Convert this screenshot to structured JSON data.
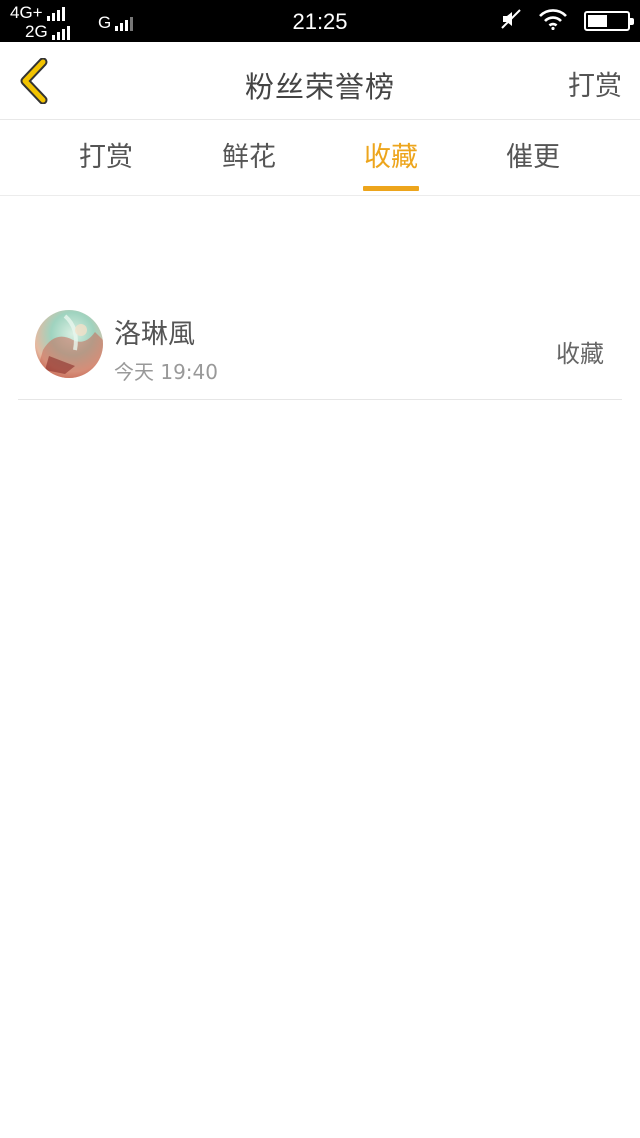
{
  "status_bar": {
    "network_1": "4G+",
    "network_2": "2G",
    "network_3": "G",
    "time": "21:25",
    "icons": [
      "signal-bars-icon",
      "mute-icon",
      "wifi-icon",
      "battery-icon"
    ],
    "battery_level": 0.5
  },
  "header": {
    "title": "粉丝荣誉榜",
    "action_label": "打赏",
    "back_icon": "chevron-left-icon",
    "back_icon_color": "#f2c300"
  },
  "tabs": [
    {
      "label": "打赏",
      "active": false
    },
    {
      "label": "鲜花",
      "active": false
    },
    {
      "label": "收藏",
      "active": true
    },
    {
      "label": "催更",
      "active": false
    }
  ],
  "accent_color": "#eda51c",
  "list": {
    "items": [
      {
        "name": "洛琳風",
        "time": "今天 19:40",
        "type": "收藏",
        "avatar_icon": "user-avatar"
      }
    ]
  }
}
